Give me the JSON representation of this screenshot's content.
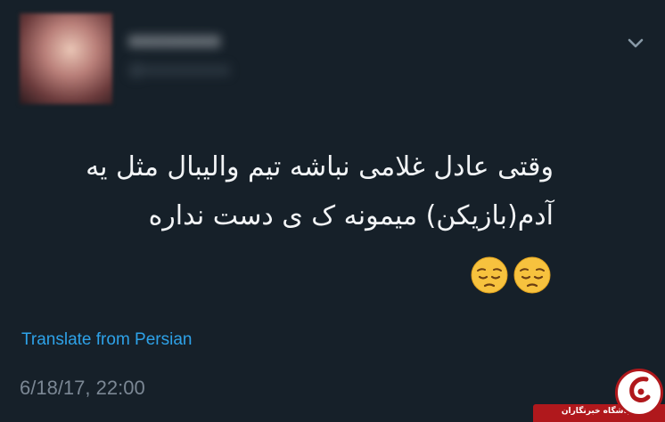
{
  "tweet": {
    "text_line1": "وقتی عادل غلامی نباشه تیم والیبال مثل یه",
    "text_line2": "آدم(بازیکن) میمونه ک ی دست نداره",
    "emojis": [
      "pensive-face",
      "pensive-face"
    ],
    "translate_label": "Translate from Persian",
    "timestamp": "6/18/17, 22:00"
  },
  "colors": {
    "background": "#162029",
    "text": "#f2f4f6",
    "link": "#2ea2e8",
    "meta": "#7b8794",
    "watermark_red": "#b0181c"
  },
  "icons": {
    "menu": "chevron-down-icon"
  },
  "watermark": {
    "text": "باشگاه خبرنگاران"
  }
}
